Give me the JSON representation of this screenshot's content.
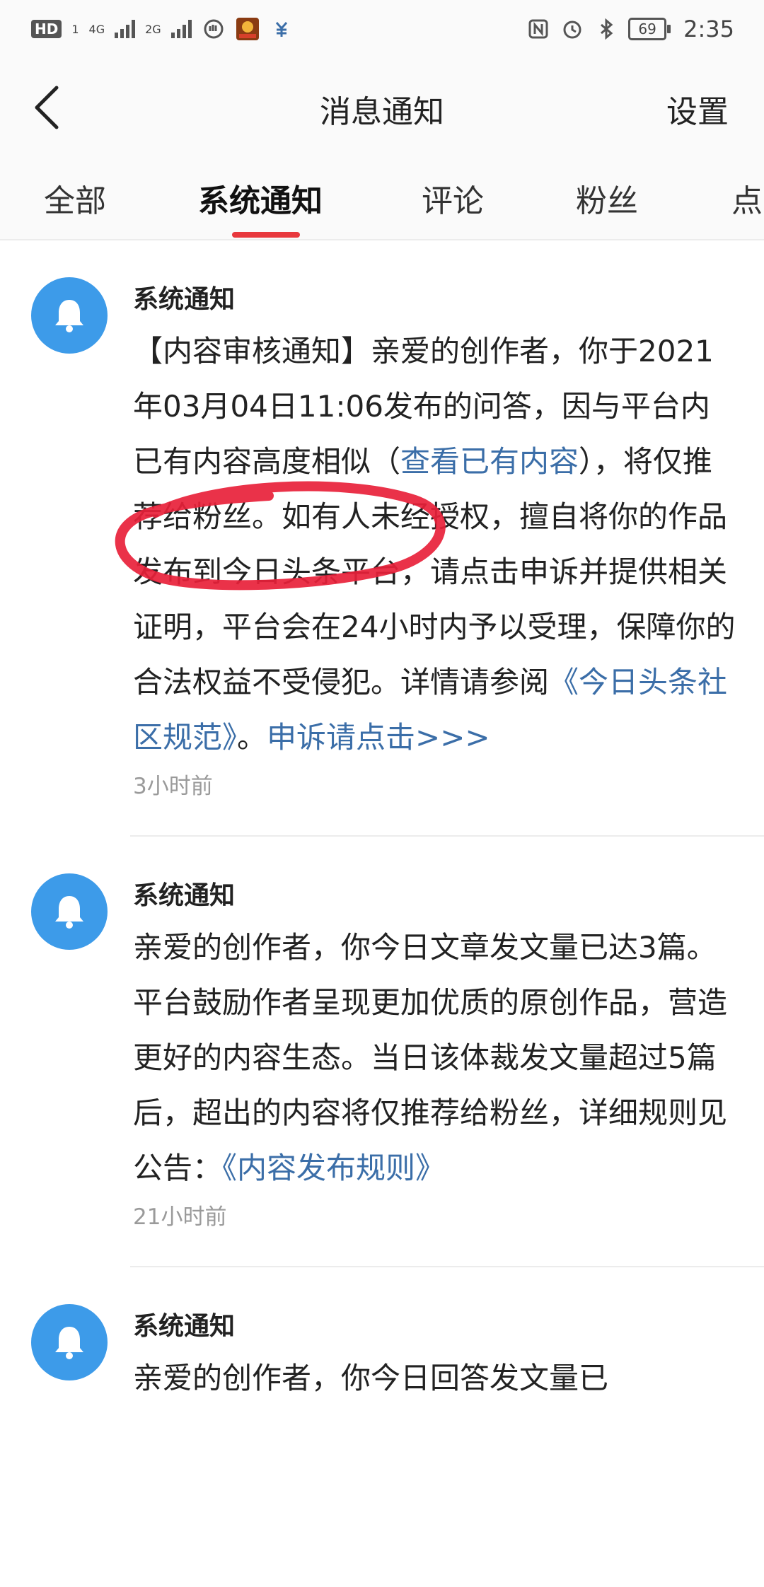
{
  "status_bar": {
    "left_badge": "HD",
    "left_sub": "1",
    "net1": "4G",
    "net2": "2G",
    "battery": "69",
    "time": "2:35"
  },
  "header": {
    "title": "消息通知",
    "settings_label": "设置"
  },
  "tabs": [
    {
      "label": "全部"
    },
    {
      "label": "系统通知"
    },
    {
      "label": "评论"
    },
    {
      "label": "粉丝"
    },
    {
      "label": "点"
    }
  ],
  "notifications": [
    {
      "sender": "系统通知",
      "parts": [
        {
          "text": "【内容审核通知】亲爱的创作者，你于2021年03月04日11:06发布的问答，因与平台内已有内容高度相似（",
          "link": false
        },
        {
          "text": "查看已有内容",
          "link": true
        },
        {
          "text": "），将仅推荐给粉丝。如有人未经授权，擅自将你的作品发布到今日头条平台，请点击申诉并提供相关证明，平台会在24小时内予以受理，保障你的合法权益不受侵犯。详情请参阅",
          "link": false
        },
        {
          "text": "《今日头条社区规范》",
          "link": true
        },
        {
          "text": "。",
          "link": false
        },
        {
          "text": "申诉请点击>>>",
          "link": true
        }
      ],
      "time": "3小时前"
    },
    {
      "sender": "系统通知",
      "parts": [
        {
          "text": "亲爱的创作者，你今日文章发文量已达3篇。平台鼓励作者呈现更加优质的原创作品，营造更好的内容生态。当日该体裁发文量超过5篇后，超出的内容将仅推荐给粉丝，详细规则见公告：",
          "link": false
        },
        {
          "text": "《内容发布规则》",
          "link": true
        }
      ],
      "time": "21小时前"
    },
    {
      "sender": "系统通知",
      "parts": [
        {
          "text": "亲爱的创作者，你今日回答发文量已",
          "link": false
        }
      ],
      "time": ""
    }
  ],
  "colors": {
    "accent": "#e8383d",
    "link": "#3b6ea8",
    "avatar": "#3d9be9",
    "annotation": "#e8213a"
  },
  "icons": {
    "back": "chevron-left-icon",
    "avatar": "bell-icon"
  }
}
